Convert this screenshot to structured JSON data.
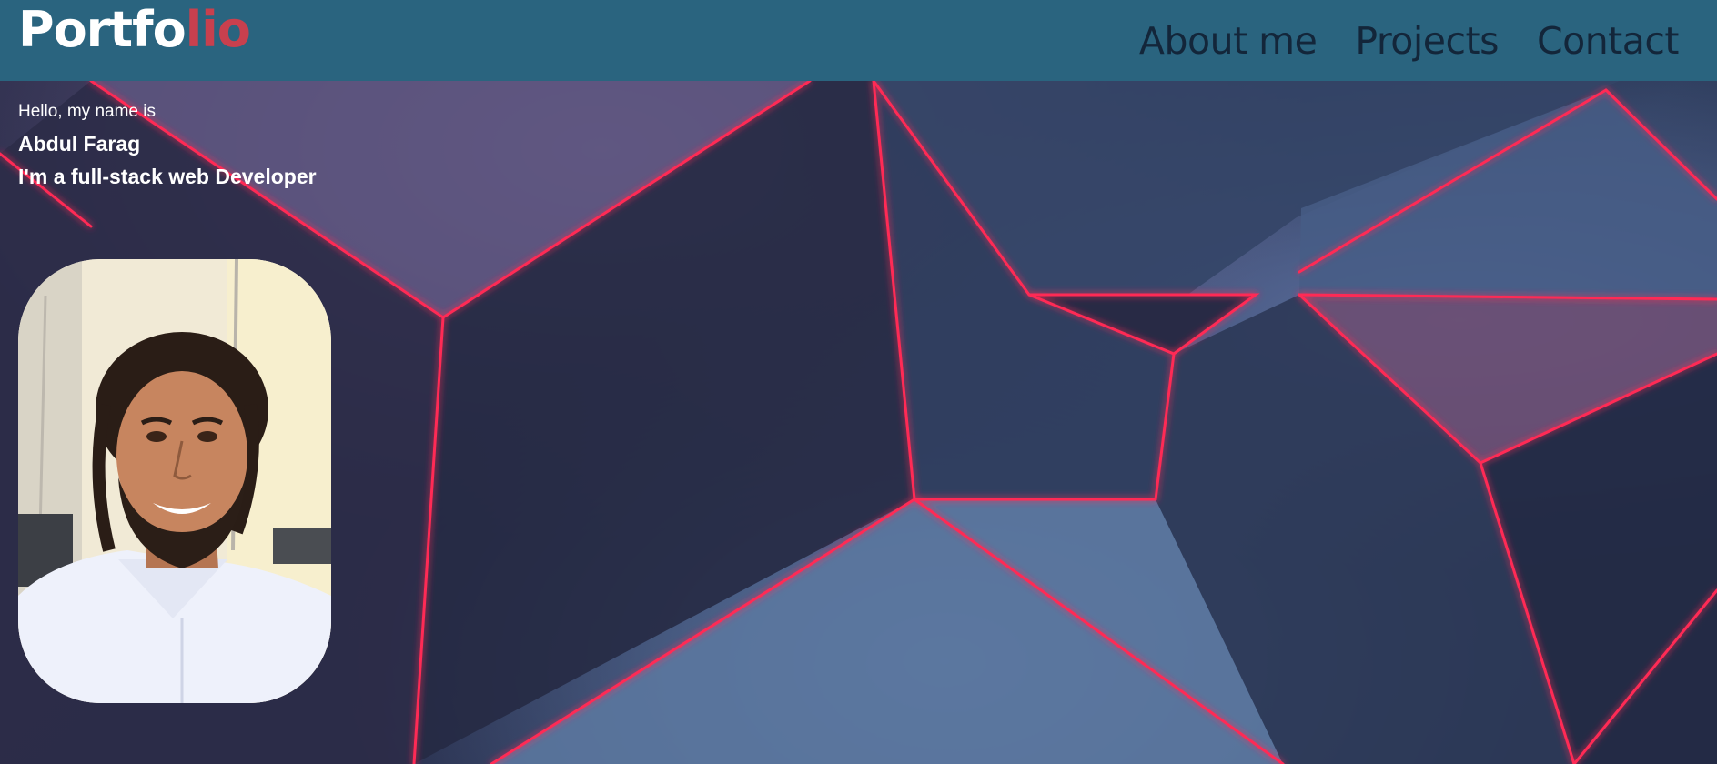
{
  "header": {
    "logo": {
      "main": "Portfo",
      "accent": "lio"
    },
    "nav": [
      {
        "label": "About me"
      },
      {
        "label": "Projects"
      },
      {
        "label": "Contact"
      }
    ]
  },
  "hero": {
    "greeting": "Hello, my name is",
    "name": "Abdul Farag",
    "role": "I'm a full-stack web Developer"
  },
  "colors": {
    "header_bg": "#2a647f",
    "logo_accent": "#c8404e",
    "nav_text": "#13263a",
    "neon_edge": "#ff2a55"
  }
}
